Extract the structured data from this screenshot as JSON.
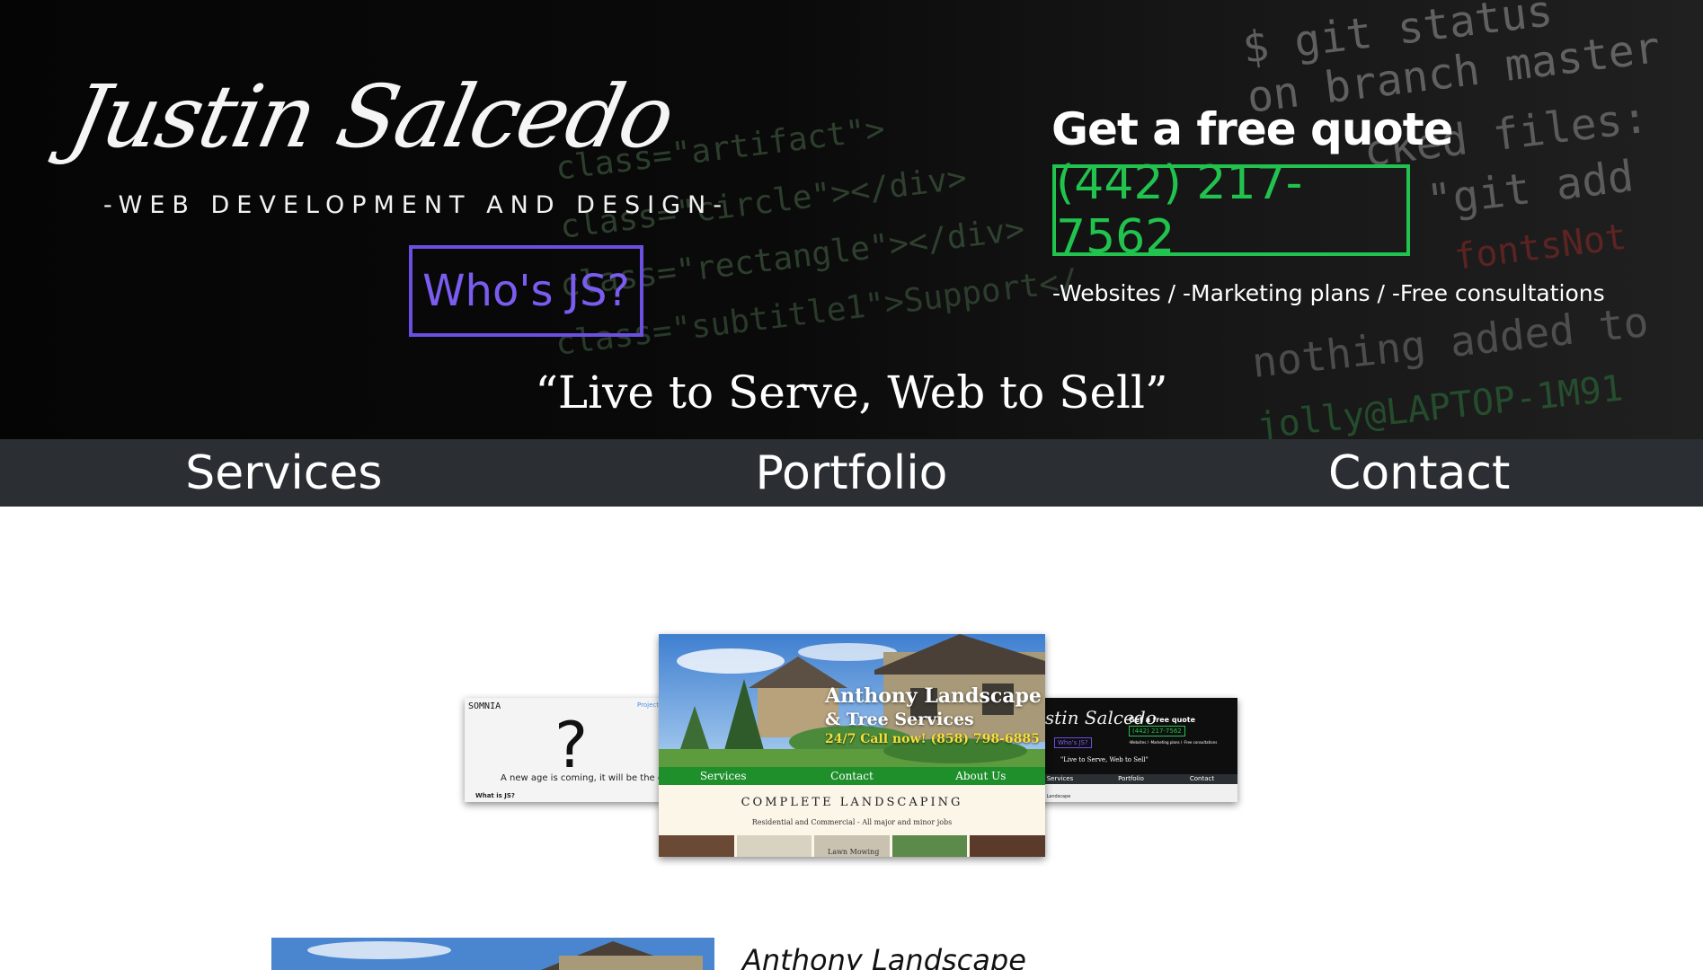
{
  "header": {
    "logo_name": "Justin Salcedo",
    "tagline": "-WEB DEVELOPMENT AND DESIGN-",
    "whos_js": "Who's JS?",
    "quote_heading": "Get a free quote",
    "phone": "(442) 217-7562",
    "services_line": "-Websites / -Marketing plans / -Free consultations",
    "motto": "“Live to Serve, Web to Sell”"
  },
  "background_code": [
    "$ git status",
    "on branch master",
    "cked files:",
    "\"git add",
    "class=\"artifact\">",
    "class=\"circle\"></div>",
    "class=\"rectangle\"></div>",
    "class=\"subtitle1\">Support</",
    "fontsNot",
    "nothing added to",
    "jolly@LAPTOP-1M91"
  ],
  "nav": {
    "items": [
      {
        "label": "Services"
      },
      {
        "label": "Portfolio"
      },
      {
        "label": "Contact"
      }
    ]
  },
  "carousel": {
    "left_slide": {
      "brand": "SOMNIA",
      "link": "Project",
      "glyph": "?",
      "text": "A new age is coming, it will be the cause",
      "subheading": "What is JS?"
    },
    "center_slide": {
      "title": "Anthony Landscape",
      "subtitle": "& Tree Services",
      "call": "24/7 Call now! (858) 798-6885",
      "nav": [
        "Services",
        "Contact",
        "About Us"
      ],
      "heading": "COMPLETE LANDSCAPING",
      "description": "Residential and Commercial - All major and minor jobs",
      "strip_label": "Lawn Mowing"
    },
    "right_slide": {
      "logo": "Justin Salcedo",
      "quote": "Get a free quote",
      "phone": "(442) 217-7562",
      "whos_js": "Who's JS?",
      "services": "-Websites / -Marketing plans / -Free consultations",
      "motto": "\"Live to Serve, Web to Sell\"",
      "nav": [
        "Services",
        "Portfolio",
        "Contact"
      ],
      "caption": "Anthony Landscape"
    }
  },
  "portfolio": {
    "first_title": "Anthony Landscape"
  },
  "colors": {
    "accent_purple": "#6b4fe0",
    "accent_green": "#22c24e",
    "nav_bg": "#2b2f33",
    "landscape_green": "#1e8f2b"
  }
}
